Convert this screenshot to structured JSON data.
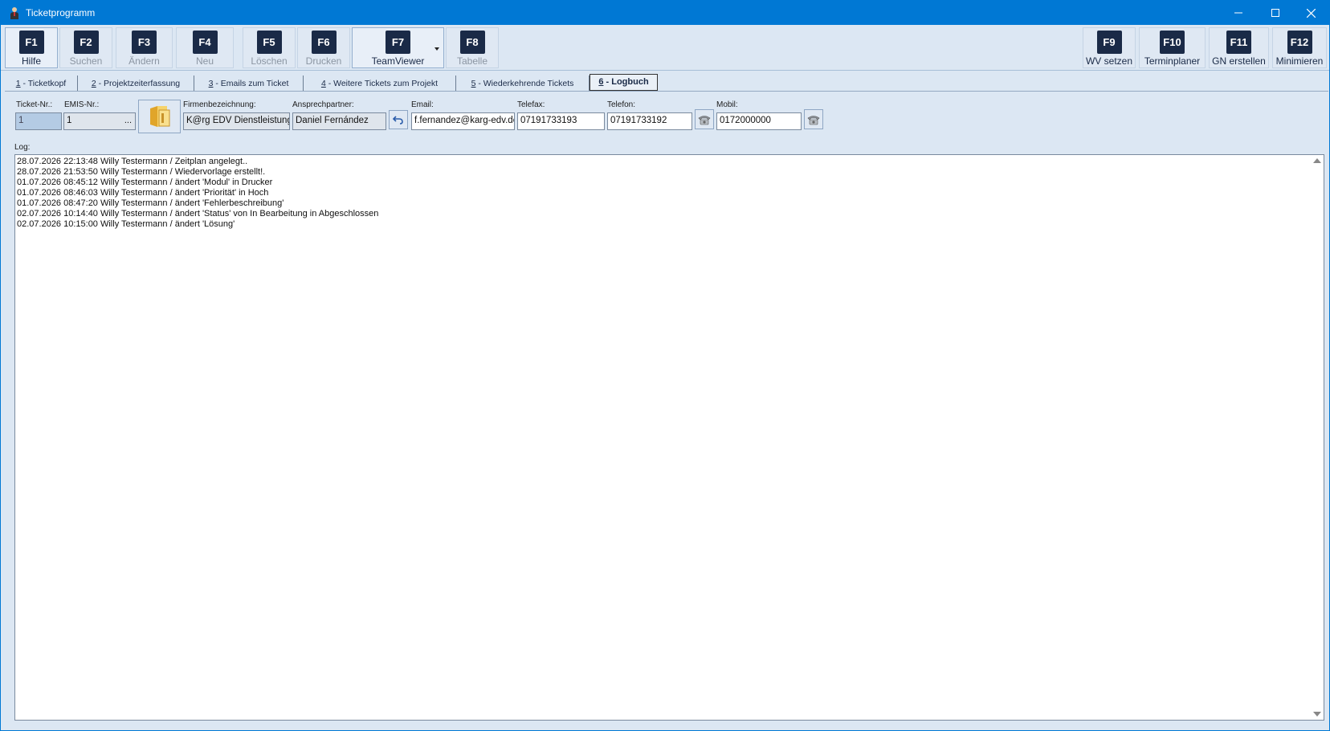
{
  "window": {
    "title": "Ticketprogramm",
    "icons": {
      "app": "person-icon",
      "minimize": "minimize-icon",
      "maximize": "maximize-icon",
      "close": "close-icon"
    }
  },
  "toolbar": {
    "left": [
      {
        "key": "F1",
        "label": "Hilfe",
        "enabled": true
      },
      {
        "key": "F2",
        "label": "Suchen",
        "enabled": false
      },
      {
        "key": "F3",
        "label": "Ändern",
        "enabled": false
      },
      {
        "key": "F4",
        "label": "Neu",
        "enabled": false
      },
      {
        "key": "F5",
        "label": "Löschen",
        "enabled": false
      },
      {
        "key": "F6",
        "label": "Drucken",
        "enabled": false
      },
      {
        "key": "F7",
        "label": "TeamViewer",
        "enabled": true
      },
      {
        "key": "F8",
        "label": "Tabelle",
        "enabled": false
      }
    ],
    "right": [
      {
        "key": "F9",
        "label": "WV setzen",
        "enabled": true
      },
      {
        "key": "F10",
        "label": "Terminplaner",
        "enabled": true
      },
      {
        "key": "F11",
        "label": "GN erstellen",
        "enabled": true
      },
      {
        "key": "F12",
        "label": "Minimieren",
        "enabled": true
      }
    ]
  },
  "tabs": [
    {
      "num": "1",
      "label": " - Ticketkopf"
    },
    {
      "num": "2",
      "label": " - Projektzeiterfassung"
    },
    {
      "num": "3",
      "label": " - Emails zum Ticket"
    },
    {
      "num": "4",
      "label": " - Weitere Tickets zum Projekt"
    },
    {
      "num": "5",
      "label": " - Wiederkehrende Tickets"
    },
    {
      "num": "6",
      "label": " - Logbuch",
      "active": true
    }
  ],
  "fields": {
    "ticket_nr": {
      "label": "Ticket-Nr.:",
      "value": "1"
    },
    "emis_nr": {
      "label": "EMIS-Nr.:",
      "value": "1",
      "button": "..."
    },
    "firma": {
      "label": "Firmenbezeichnung:",
      "value": "K@rg EDV Dienstleistungen"
    },
    "ansprechpartner": {
      "label": "Ansprechpartner:",
      "value": "Daniel Fernández"
    },
    "email": {
      "label": "Email:",
      "value": "f.fernandez@karg-edv.de"
    },
    "telefax": {
      "label": "Telefax:",
      "value": "07191733193"
    },
    "telefon": {
      "label": "Telefon:",
      "value": "07191733192"
    },
    "mobil": {
      "label": "Mobil:",
      "value": "0172000000"
    }
  },
  "icons": {
    "folder": "folder-icon",
    "undo": "undo-icon",
    "phone": "phone-icon"
  },
  "log": {
    "label": "Log:",
    "lines": [
      "28.07.2026 22:13:48 Willy Testermann / Zeitplan angelegt..",
      "28.07.2026 21:53:50 Willy Testermann / Wiedervorlage erstellt!.",
      "01.07.2026 08:45:12 Willy Testermann / ändert 'Modul' in Drucker",
      "01.07.2026 08:46:03 Willy Testermann / ändert 'Priorität' in Hoch",
      "01.07.2026 08:47:20 Willy Testermann / ändert 'Fehlerbeschreibung'",
      "02.07.2026 10:14:40 Willy Testermann / ändert 'Status' von In Bearbeitung in Abgeschlossen",
      "02.07.2026 10:15:00 Willy Testermann / ändert 'Lösung'"
    ]
  },
  "colors": {
    "titlebar": "#0078d4",
    "fkey": "#1a2a47",
    "background": "#dce7f3"
  }
}
